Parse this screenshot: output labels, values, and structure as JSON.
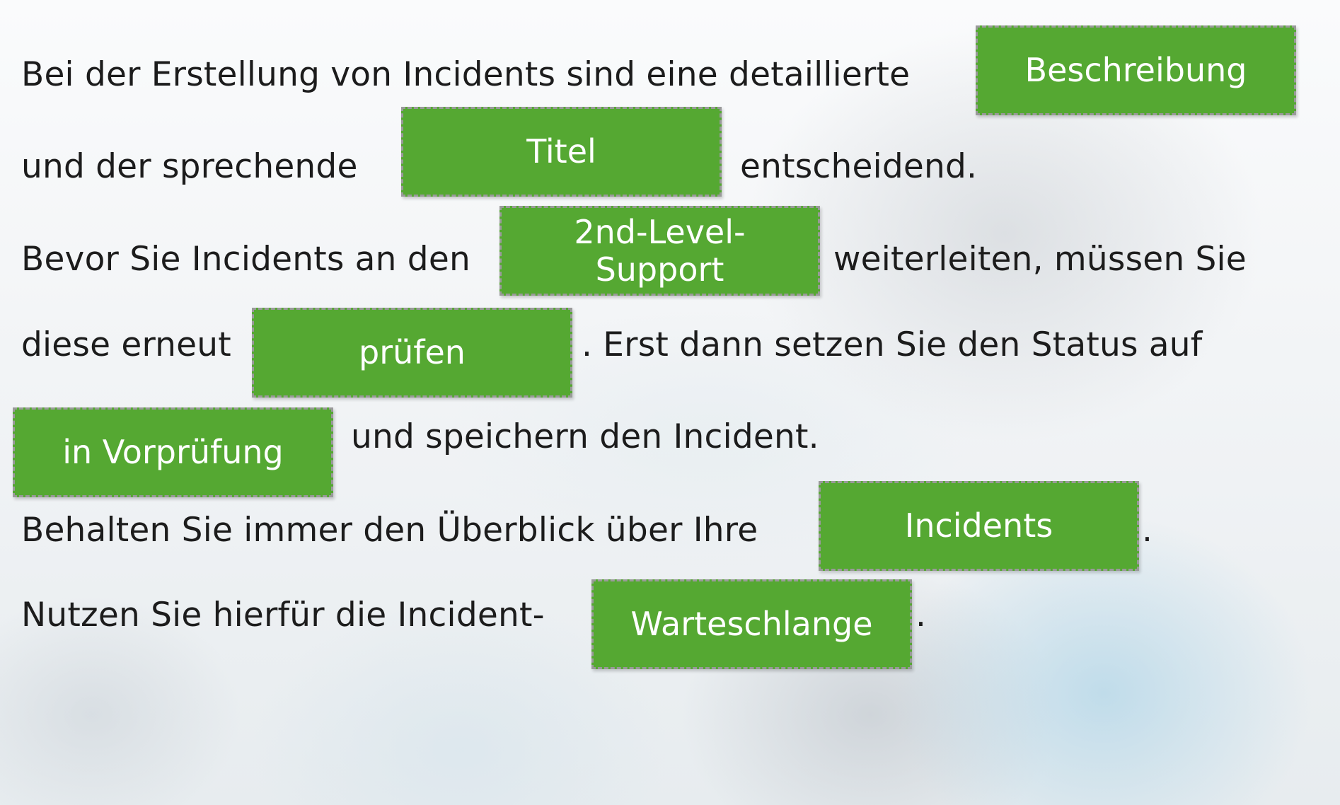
{
  "sentences": [
    {
      "text": "Bei der Erstellung von Incidents sind eine detaillierte"
    },
    {
      "text": "und der sprechende"
    },
    {
      "text": "entscheidend."
    },
    {
      "text": "Bevor Sie Incidents an den"
    },
    {
      "text": "weiterleiten, müssen Sie"
    },
    {
      "text": "diese erneut"
    },
    {
      "text": ". Erst dann setzen Sie den Status auf"
    },
    {
      "text": "und speichern den Incident."
    },
    {
      "text": "Behalten Sie immer den Überblick über Ihre"
    },
    {
      "text": "."
    },
    {
      "text": "Nutzen Sie hierfür die Incident-"
    },
    {
      "text": "."
    }
  ],
  "tokens": [
    {
      "label": "Beschreibung"
    },
    {
      "label": "Titel"
    },
    {
      "label": "2nd-Level-\nSupport"
    },
    {
      "label": "prüfen"
    },
    {
      "label": "in Vorprüfung"
    },
    {
      "label": "Incidents"
    },
    {
      "label": "Warteschlange"
    }
  ],
  "colors": {
    "token_fill": "#55a832",
    "token_border": "#9a9a9a",
    "text": "#1c1c1c",
    "token_text": "#ffffff"
  }
}
